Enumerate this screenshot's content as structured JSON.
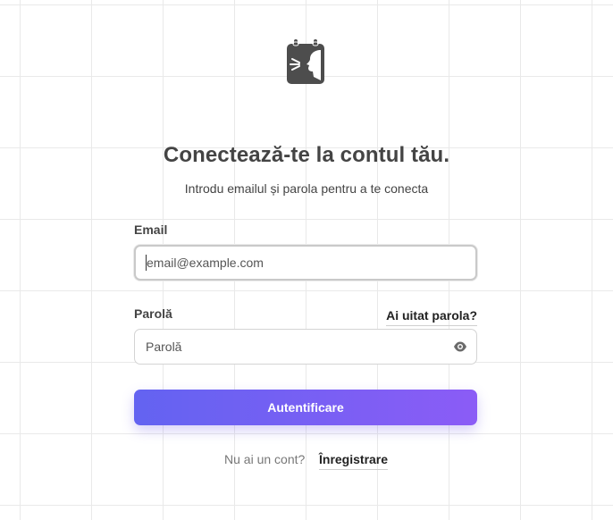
{
  "brand": {
    "logo_icon": "notepad-speaking-person-icon"
  },
  "login": {
    "title": "Conectează-te la contul tău.",
    "subtitle": "Introdu emailul și parola pentru a te conecta",
    "email_label": "Email",
    "email_placeholder": "email@example.com",
    "email_value": "",
    "password_label": "Parolă",
    "password_placeholder": "Parolă",
    "password_value": "",
    "forgot_link": "Ai uitat parola?",
    "show_password_icon": "eye-icon",
    "submit_label": "Autentificare",
    "no_account_text": "Nu ai un cont?",
    "register_link": "Înregistrare"
  },
  "colors": {
    "button_gradient_start": "#6363f1",
    "button_gradient_end": "#8b5cf6",
    "text_dark": "#444444",
    "grid_line": "#e9e9e9"
  }
}
